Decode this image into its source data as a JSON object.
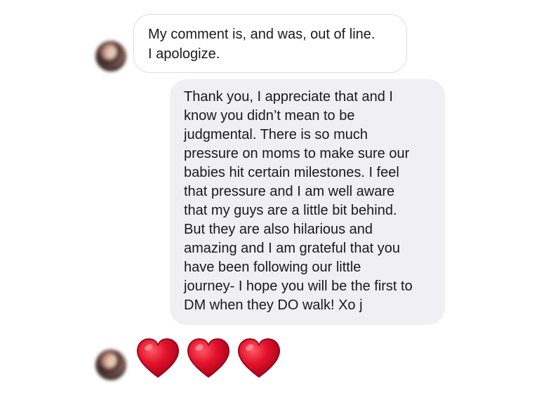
{
  "messages": {
    "incoming_1": {
      "lines": [
        "My comment is, and was, out of line.",
        "I apologize."
      ]
    },
    "outgoing_1": {
      "lines": [
        "Thank you, I appreciate that and I",
        "know you didn’t mean to be",
        "judgmental. There is so much",
        "pressure on moms to make sure our",
        "babies hit certain milestones. I feel",
        "that pressure and I am well aware",
        "that my guys are a little bit behind.",
        "But they are also hilarious and",
        "amazing and I am grateful that you",
        "have been following our little",
        "journey- I hope you will be the first to",
        "DM when they DO walk! Xo j"
      ]
    },
    "incoming_2": {
      "emoji": [
        "red-heart",
        "red-heart",
        "red-heart"
      ]
    }
  },
  "colors": {
    "outgoing_bubble": "#efeff4",
    "incoming_border": "#dcdcdc",
    "heart": "#e0102a"
  }
}
